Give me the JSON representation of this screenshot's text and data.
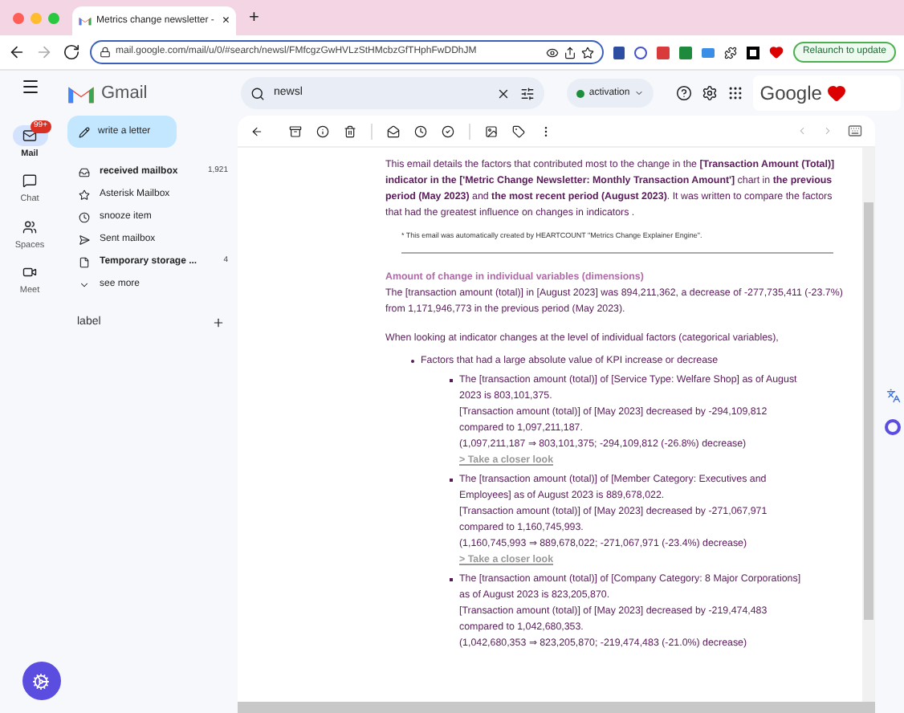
{
  "browser": {
    "tab_title": "Metrics change newsletter -",
    "tab_close": "×",
    "new_tab": "+",
    "url": "mail.google.com/mail/u/0/#search/newsl/FMfcgzGwHVLzStHMcbzGfTHphFwDDhJM",
    "relaunch": "Relaunch to update"
  },
  "gmail": {
    "logo": "Gmail",
    "search_value": "newsl",
    "status": "activation",
    "account": "Google"
  },
  "rail": [
    {
      "label": "Mail",
      "selected": true,
      "badge": "99+"
    },
    {
      "label": "Chat",
      "selected": false
    },
    {
      "label": "Spaces",
      "selected": false
    },
    {
      "label": "Meet",
      "selected": false
    }
  ],
  "compose": "write a letter",
  "folders": [
    {
      "label": "received mailbox",
      "count": "1,921",
      "bold": true
    },
    {
      "label": "Asterisk Mailbox",
      "bold": false
    },
    {
      "label": "snooze item",
      "bold": false
    },
    {
      "label": "Sent mailbox",
      "bold": false
    },
    {
      "label": "Temporary storage ...",
      "count": "4",
      "bold": true
    },
    {
      "label": "see more",
      "bold": false
    }
  ],
  "labels_heading": "label",
  "email": {
    "intro": "This email details  the factors that contributed most to the change in the  **[Transaction Amount (Total)] indicator in the ['Metric Change Newsletter: Monthly Transaction Amount']**  chart in **the previous period (May 2023)** and  **the most recent period (August 2023)**. It was written to compare the factors that had the greatest influence on changes in indicators .",
    "note": "* This email was automatically created by HEARTCOUNT \"Metrics Change Explainer Engine\".",
    "section_title": "Amount of change in individual variables (dimensions)",
    "summary": "The [transaction amount (total)] in [August 2023] was 894,211,362, a decrease of -277,735,411 (-23.7%) from 1,171,946,773 in the previous period (May 2023).",
    "lead": "When looking at indicator changes at the level of individual factors (categorical variables),",
    "bullets": [
      {
        "text": "Factors that had a large absolute value of KPI increase or decrease",
        "children": [
          {
            "lines": [
              "The [transaction amount (total)] of [Service Type: Welfare Shop] as of August 2023 is 803,101,375.",
              "[Transaction amount (total)] of [May 2023] decreased by -294,109,812 compared to 1,097,211,187.",
              "(1,097,211,187 ⇒ 803,101,375; -294,109,812 (-26.8%) decrease)"
            ],
            "link": "> Take a closer look"
          },
          {
            "lines": [
              "The [transaction amount (total)] of [Member Category: Executives and Employees] as of August 2023 is 889,678,022.",
              "[Transaction amount (total)] of [May 2023] decreased by -271,067,971 compared to 1,160,745,993.",
              "(1,160,745,993 ⇒ 889,678,022; -271,067,971 (-23.4%) decrease)"
            ],
            "link": "> Take a closer look"
          },
          {
            "lines": [
              "The [transaction amount (total)] of [Company Category: 8 Major Corporations] as of August 2023 is 823,205,870.",
              "[Transaction amount (total)] of [May 2023] decreased by -219,474,483 compared to 1,042,680,353.",
              "(1,042,680,353 ⇒ 823,205,870; -219,474,483 (-21.0%) decrease)"
            ]
          }
        ]
      }
    ]
  }
}
